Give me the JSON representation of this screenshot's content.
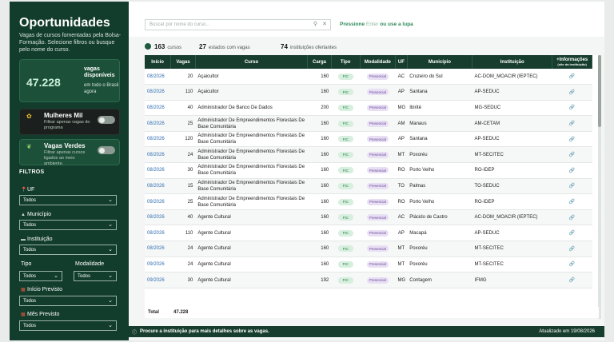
{
  "sidebar": {
    "title": "Oportunidades",
    "description": "Vagas de cursos fomentadas pela Bolsa-Formação. Selecione filtros ou busque pelo nome do curso.",
    "vagas_number": "47.228",
    "vagas_label": "vagas disponíveis",
    "vagas_sub": "em todo o Brasil agora",
    "mulheres_title": "Mulheres Mil",
    "mulheres_sub": "Filtrar apenas vagas do programa",
    "verdes_title": "Vagas Verdes",
    "verdes_sub": "Filtrar apenas cursos ligados ao meio ambiente.",
    "filtros_label": "FILTROS",
    "uf_label": "UF",
    "uf_value": "Todos",
    "municipio_label": "Município",
    "municipio_value": "Todos",
    "instituicao_label": "Instituição",
    "instituicao_value": "Todos",
    "tipo_label": "Tipo",
    "tipo_value": "Todos",
    "modalidade_label": "Modalidade",
    "modalidade_value": "Todos",
    "inicio_label": "Início Previsto",
    "inicio_value": "Todos",
    "mes_label": "Mês Previsto",
    "mes_value": "Todos"
  },
  "search": {
    "placeholder": "Buscar por nome do curso...",
    "hint_press": "Pressione",
    "hint_enter": "Enter",
    "hint_rest": "ou use a lupa"
  },
  "stats": {
    "cursos_num": "163",
    "cursos_label": "cursos",
    "estados_num": "27",
    "estados_label": "estados com vagas",
    "instituicoes_num": "74",
    "instituicoes_label": "instituições ofertantes"
  },
  "table": {
    "headers": [
      "Início",
      "Vagas",
      "Curso",
      "Carga",
      "Tipo",
      "Modalidade",
      "UF",
      "Município",
      "Instituição",
      "+Informações"
    ],
    "headers_sub": "(site da instituição)",
    "rows": [
      [
        "08/2026",
        "20",
        "Açaicultor",
        "160",
        "FIC",
        "Presencial",
        "AC",
        "Cruzeiro do Sul",
        "AC-DOM_MOACIR (IEPTEC)"
      ],
      [
        "08/2026",
        "110",
        "Açaicultor",
        "160",
        "FIC",
        "Presencial",
        "AP",
        "Santana",
        "AP-SEDUC"
      ],
      [
        "08/2026",
        "40",
        "Administrador De Banco De Dados",
        "200",
        "FIC",
        "Presencial",
        "MG",
        "Ibirité",
        "MG-SEDUC"
      ],
      [
        "08/2026",
        "25",
        "Administrador De Empreendimentos Florestais De Base Comunitária",
        "160",
        "FIC",
        "Presencial",
        "AM",
        "Manaus",
        "AM-CETAM"
      ],
      [
        "08/2026",
        "120",
        "Administrador De Empreendimentos Florestais De Base Comunitária",
        "160",
        "FIC",
        "Presencial",
        "AP",
        "Santana",
        "AP-SEDUC"
      ],
      [
        "08/2026",
        "24",
        "Administrador De Empreendimentos Florestais De Base Comunitária",
        "160",
        "FIC",
        "Presencial",
        "MT",
        "Poxoréu",
        "MT-SECITEC"
      ],
      [
        "08/2026",
        "30",
        "Administrador De Empreendimentos Florestais De Base Comunitária",
        "160",
        "FIC",
        "Presencial",
        "RO",
        "Porto Velho",
        "RO-IDEP"
      ],
      [
        "08/2026",
        "15",
        "Administrador De Empreendimentos Florestais De Base Comunitária",
        "160",
        "FIC",
        "Presencial",
        "TO",
        "Palmas",
        "TO-SEDUC"
      ],
      [
        "09/2026",
        "25",
        "Administrador De Empreendimentos Florestais De Base Comunitária",
        "160",
        "FIC",
        "Presencial",
        "RO",
        "Porto Velho",
        "RO-IDEP"
      ],
      [
        "08/2026",
        "40",
        "Agente Cultural",
        "160",
        "FIC",
        "Presencial",
        "AC",
        "Plácido de Castro",
        "AC-DOM_MOACIR (IEPTEC)"
      ],
      [
        "08/2026",
        "110",
        "Agente Cultural",
        "160",
        "FIC",
        "Presencial",
        "AP",
        "Macapá",
        "AP-SEDUC"
      ],
      [
        "08/2026",
        "24",
        "Agente Cultural",
        "160",
        "FIC",
        "Presencial",
        "MT",
        "Poxoréu",
        "MT-SECITEC"
      ],
      [
        "09/2026",
        "24",
        "Agente Cultural",
        "160",
        "FIC",
        "Presencial",
        "MT",
        "Poxoréu",
        "MT-SECITEC"
      ],
      [
        "09/2026",
        "30",
        "Agente Cultural",
        "192",
        "FIC",
        "Presencial",
        "MG",
        "Contagem",
        "IFMG"
      ]
    ],
    "total_label": "Total",
    "total_value": "47.228"
  },
  "footer": {
    "text": "Procure a instituição para mais detalhes sobre as vagas.",
    "updated": "Atualizado em 19/08/2026"
  }
}
